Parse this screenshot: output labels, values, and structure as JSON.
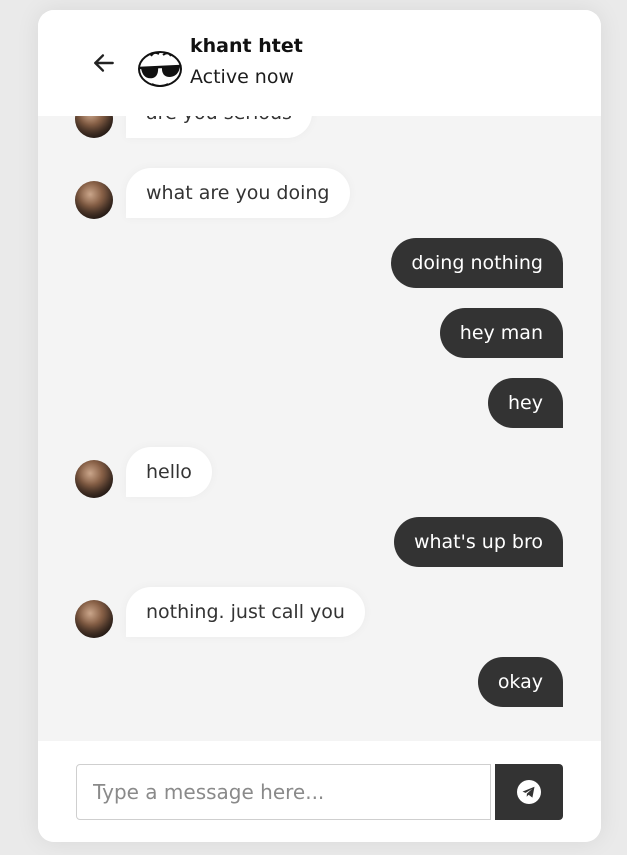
{
  "contact": {
    "name": "khant htet",
    "status": "Active now"
  },
  "messages": [
    {
      "from": "them",
      "text": "are you serious"
    },
    {
      "from": "them",
      "text": "what are you doing"
    },
    {
      "from": "me",
      "text": "doing nothing"
    },
    {
      "from": "me",
      "text": "hey man"
    },
    {
      "from": "me",
      "text": "hey"
    },
    {
      "from": "them",
      "text": "hello"
    },
    {
      "from": "me",
      "text": "what's up bro"
    },
    {
      "from": "them",
      "text": "nothing. just call you"
    },
    {
      "from": "me",
      "text": "okay"
    }
  ],
  "composer": {
    "placeholder": "Type a message here...",
    "value": ""
  },
  "icons": {
    "back": "arrow-left-icon",
    "send": "telegram-send-icon",
    "contact_avatar": "sunglasses-face-icon"
  },
  "colors": {
    "dark_bubble": "#333333",
    "light_bubble": "#ffffff",
    "chat_background": "#f4f4f4"
  }
}
